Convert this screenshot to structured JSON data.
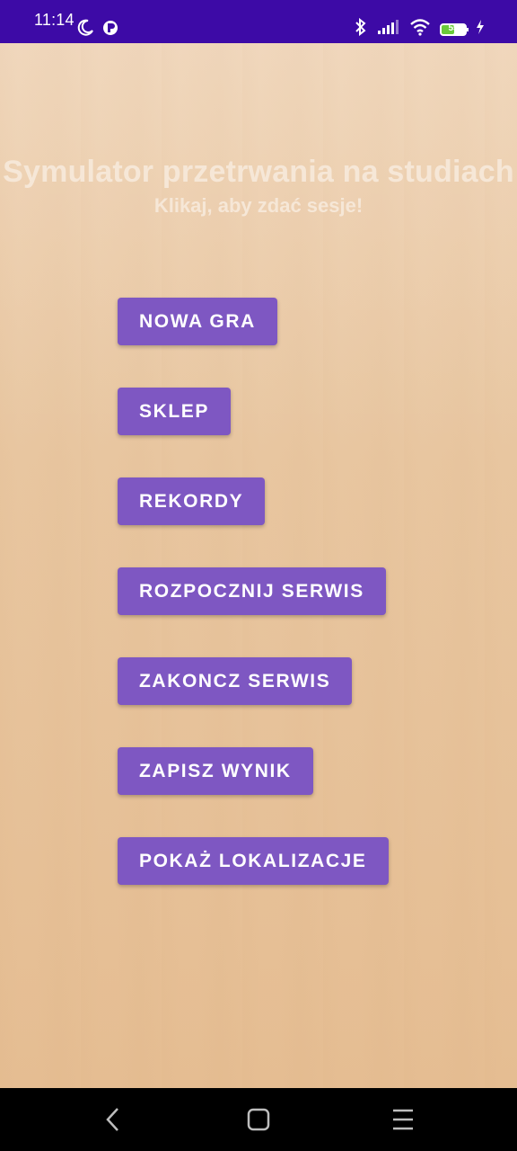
{
  "status_bar": {
    "time": "11:14",
    "battery_level": "55",
    "colors": {
      "background": "#3d0aa6",
      "battery": "#6aca3a"
    },
    "icons": [
      "moon-icon",
      "app-notification-icon",
      "bluetooth-icon",
      "signal-icon",
      "wifi-icon",
      "battery-icon",
      "charging-icon"
    ]
  },
  "app": {
    "title": "Symulator przetrwania na studiach",
    "subtitle": "Klikaj, aby zdać sesje!",
    "colors": {
      "button": "#7e57c2",
      "title": "#f6e7d7"
    }
  },
  "menu": {
    "items": [
      {
        "label": "NOWA GRA"
      },
      {
        "label": "SKLEP"
      },
      {
        "label": "REKORDY"
      },
      {
        "label": "ROZPOCZNIJ SERWIS"
      },
      {
        "label": "ZAKONCZ SERWIS"
      },
      {
        "label": "ZAPISZ WYNIK"
      },
      {
        "label": "POKAŻ LOKALIZACJE"
      }
    ]
  },
  "nav_bar": {
    "icons": [
      "back-icon",
      "home-icon",
      "menu-icon"
    ]
  }
}
